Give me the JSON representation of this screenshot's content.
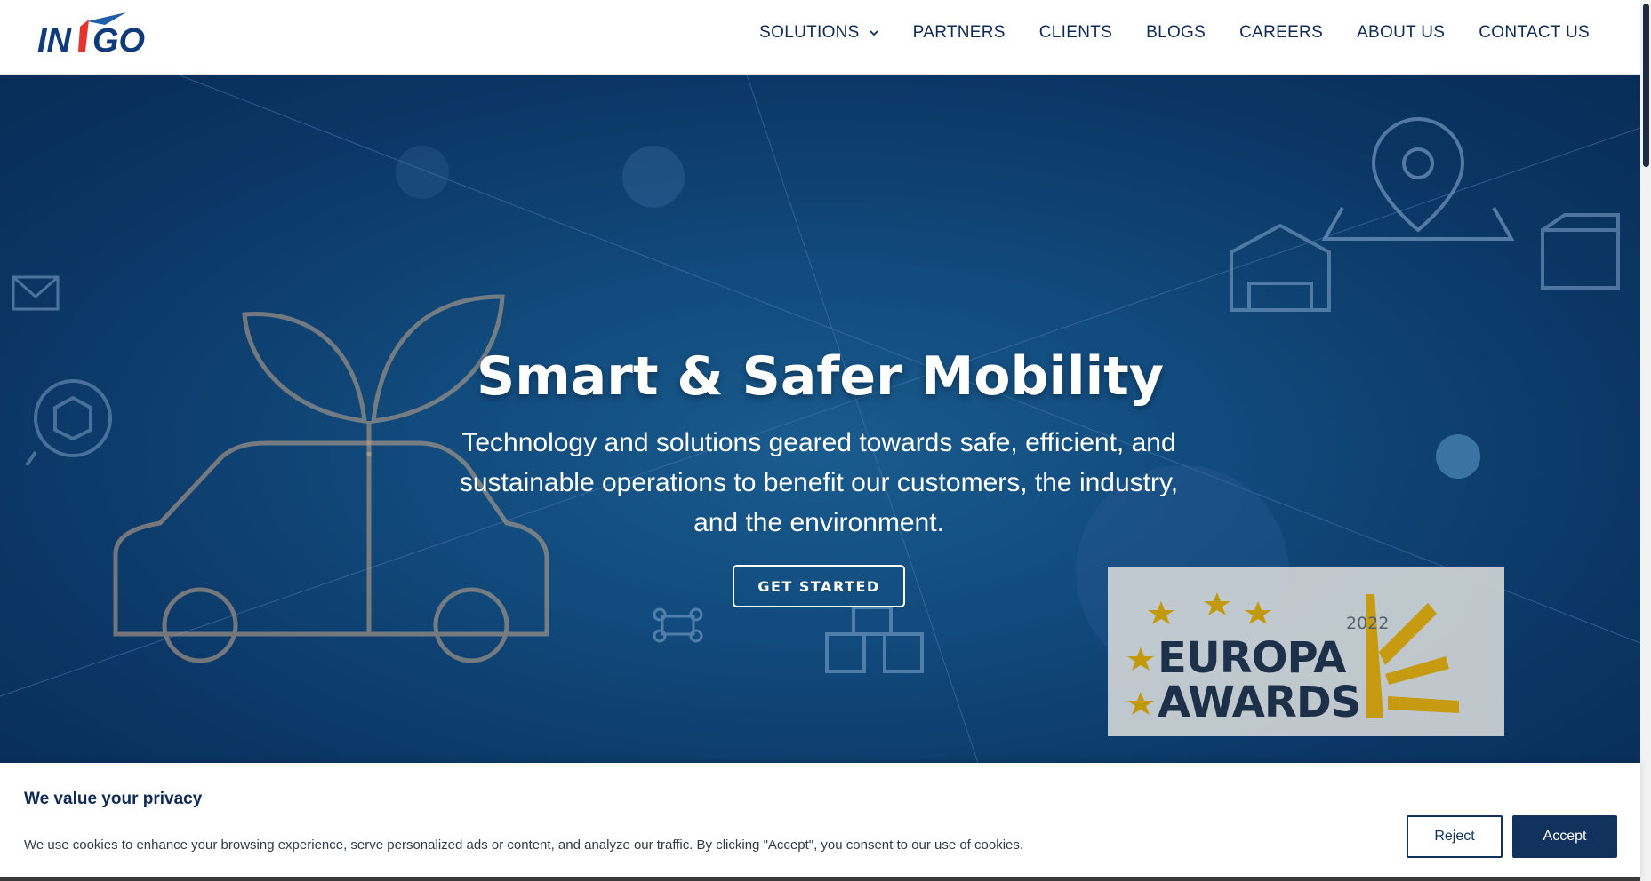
{
  "brand": {
    "logo_text": "IN1GO",
    "colors": {
      "navy": "#0e2a55",
      "accent_red": "#e1352e",
      "hero_blue": "#114a7c"
    }
  },
  "nav": {
    "items": [
      {
        "label": "SOLUTIONS",
        "has_dropdown": true
      },
      {
        "label": "PARTNERS"
      },
      {
        "label": "CLIENTS"
      },
      {
        "label": "BLOGS"
      },
      {
        "label": "CAREERS"
      },
      {
        "label": "ABOUT US"
      },
      {
        "label": "CONTACT US"
      }
    ]
  },
  "hero": {
    "title": "Smart & Safer Mobility",
    "subtitle": "Technology and solutions geared towards safe, efficient, and sustainable operations to benefit our customers, the industry, and the environment.",
    "cta_label": "GET STARTED",
    "award": {
      "year": "2022",
      "line1": "EUROPA",
      "line2": "AWARDS"
    },
    "background_icons": [
      "map-pin-icon",
      "warehouse-icon",
      "package-icon",
      "mail-icon",
      "leaf-icon",
      "car-icon",
      "box-icon",
      "drone-icon"
    ]
  },
  "cookie": {
    "title": "We value your privacy",
    "text": "We use cookies to enhance your browsing experience, serve personalized ads or content, and analyze our traffic. By clicking \"Accept\", you consent to our use of cookies.",
    "reject_label": "Reject",
    "accept_label": "Accept"
  }
}
